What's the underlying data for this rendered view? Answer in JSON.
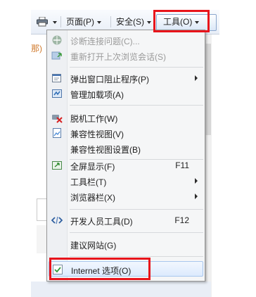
{
  "toolbar": {
    "page_label": "页面(P)",
    "safety_label": "安全(S)",
    "tools_label": "工具(O)"
  },
  "background": {
    "left_fragment": "那)"
  },
  "menu": {
    "items": [
      {
        "label": "诊断连接问题(C)...",
        "disabled": true,
        "icon": "diagnose-icon"
      },
      {
        "label": "重新打开上次浏览会话(S)",
        "disabled": true,
        "icon": "reopen-session-icon"
      },
      {
        "label": "弹出窗口阻止程序(P)",
        "submenu": true,
        "icon": "popup-blocker-icon"
      },
      {
        "label": "管理加载项(A)",
        "icon": "addons-icon"
      },
      {
        "label": "脱机工作(W)",
        "icon": "work-offline-icon"
      },
      {
        "label": "兼容性视图(V)",
        "icon": "compat-view-icon"
      },
      {
        "label": "兼容性视图设置(B)"
      },
      {
        "label": "全屏显示(F)",
        "shortcut": "F11",
        "icon": "fullscreen-icon"
      },
      {
        "label": "工具栏(T)",
        "submenu": true
      },
      {
        "label": "浏览器栏(X)",
        "submenu": true
      },
      {
        "label": "开发人员工具(D)",
        "shortcut": "F12",
        "icon": "dev-tools-icon"
      },
      {
        "label": "建议网站(G)"
      },
      {
        "label": "Internet 选项(O)",
        "icon": "internet-options-icon"
      }
    ]
  },
  "colors": {
    "highlight": "#e8141b",
    "menu_bg": "#f5f6f7"
  }
}
